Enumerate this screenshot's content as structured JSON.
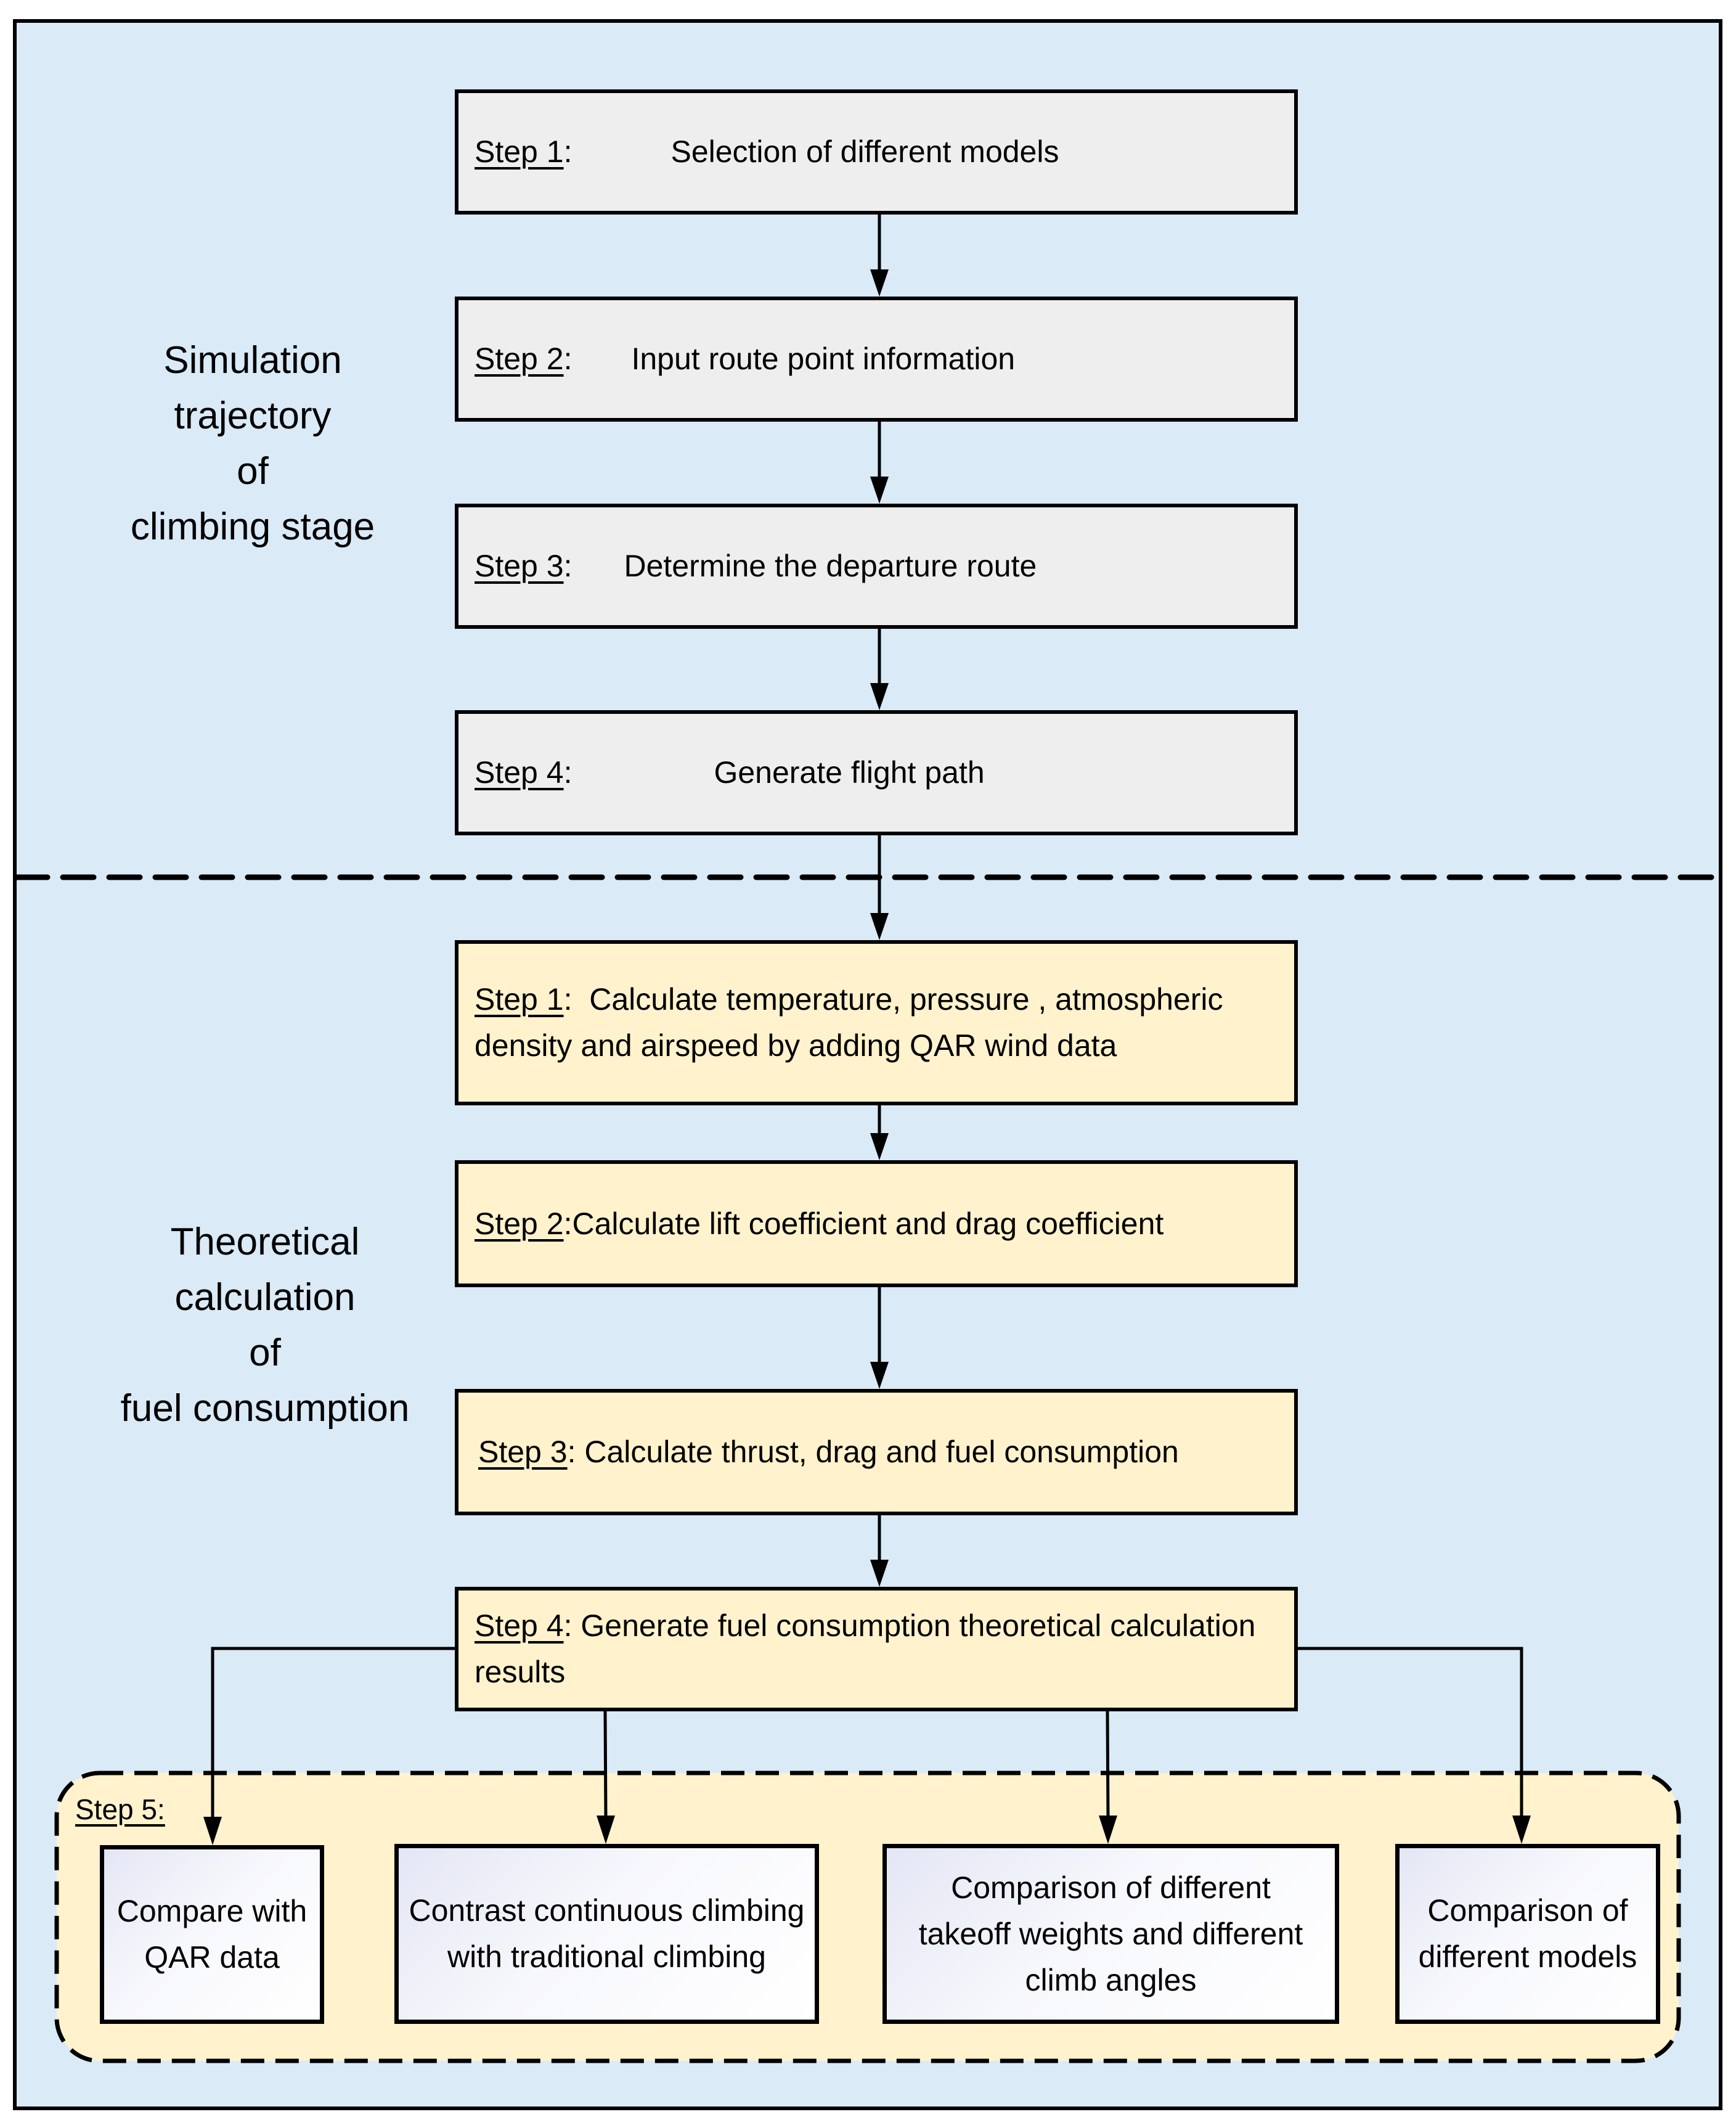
{
  "colors": {
    "background": "#daeaf6",
    "phase1_box": "#eeeeee",
    "phase2_box": "#fff2cc",
    "step5_container": "#fff2cc",
    "result_box_gradient_start": "#e4e6f4",
    "result_box_gradient_end": "#ffffff",
    "stroke": "#000000"
  },
  "phase1": {
    "label": "Simulation\ntrajectory\nof\nclimbing stage",
    "steps": [
      {
        "tag": "Step 1",
        "sep": ":",
        "text": "Selection of different models"
      },
      {
        "tag": "Step 2",
        "sep": ":",
        "text": "Input route point information"
      },
      {
        "tag": "Step 3",
        "sep": ":",
        "text": "Determine the departure route"
      },
      {
        "tag": "Step 4",
        "sep": ":",
        "text": "Generate flight path"
      }
    ]
  },
  "phase2": {
    "label": "Theoretical\ncalculation\nof\nfuel consumption",
    "steps": [
      {
        "tag": "Step 1",
        "sep": ":",
        "text": "Calculate temperature, pressure , atmospheric density and airspeed by adding QAR wind data"
      },
      {
        "tag": "Step 2",
        "sep": ":",
        "text": "Calculate lift coefficient and drag coefficient"
      },
      {
        "tag": "Step 3",
        "sep": ":",
        "text": "Calculate thrust, drag and fuel consumption"
      },
      {
        "tag": "Step 4",
        "sep": ":",
        "text": "Generate fuel consumption theoretical calculation results"
      }
    ]
  },
  "step5": {
    "label": "Step 5:",
    "results": [
      {
        "text": "Compare with QAR data"
      },
      {
        "text": "Contrast continuous climbing with traditional climbing"
      },
      {
        "text": "Comparison of different takeoff weights and different climb angles"
      },
      {
        "text": "Comparison of different models"
      }
    ]
  }
}
